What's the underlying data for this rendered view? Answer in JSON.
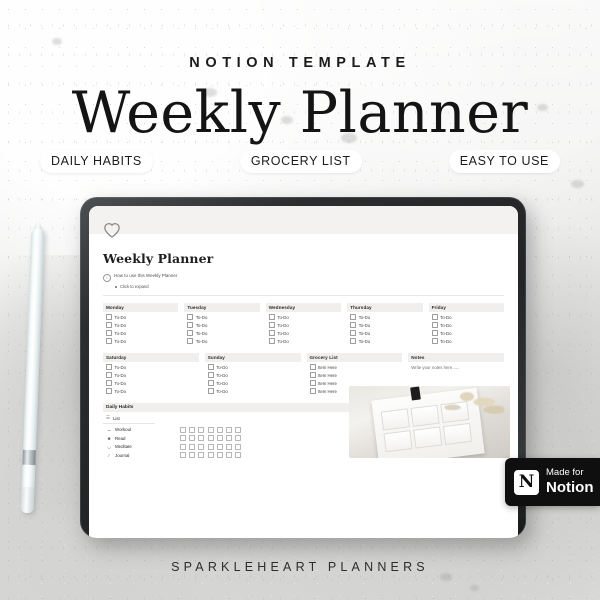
{
  "header": {
    "kicker": "NOTION TEMPLATE",
    "title": "Weekly Planner",
    "pills": [
      {
        "label": "DAILY HABITS"
      },
      {
        "label": "GROCERY LIST"
      },
      {
        "label": "EASY TO USE"
      }
    ]
  },
  "notion_page": {
    "icon": "heart-icon",
    "title": "Weekly Planner",
    "callout": {
      "icon": "info-icon",
      "text": "How to use this Weekly Planner",
      "subitem": "Click to expand"
    },
    "week_columns": [
      {
        "header": "Monday",
        "items": [
          "To-Do",
          "To-Do",
          "To-Do",
          "To-Do"
        ]
      },
      {
        "header": "Tuesday",
        "items": [
          "To-Do",
          "To-Do",
          "To-Do",
          "To-Do"
        ]
      },
      {
        "header": "Wednesday",
        "items": [
          "To-Do",
          "To-Do",
          "To-Do",
          "To-Do"
        ]
      },
      {
        "header": "Thursday",
        "items": [
          "To-Do",
          "To-Do",
          "To-Do",
          "To-Do"
        ]
      },
      {
        "header": "Friday",
        "items": [
          "To-Do",
          "To-Do",
          "To-Do",
          "To-Do"
        ]
      }
    ],
    "second_row_columns": [
      {
        "header": "Saturday",
        "items": [
          "To-Do",
          "To-Do",
          "To-Do",
          "To-Do"
        ]
      },
      {
        "header": "Sunday",
        "items": [
          "To-Do",
          "To-Do",
          "To-Do",
          "To-Do"
        ]
      },
      {
        "header": "Grocery List",
        "items": [
          "Item Here",
          "Item Here",
          "Item Here",
          "Item Here"
        ]
      }
    ],
    "notes": {
      "header": "Notes",
      "placeholder": "Write your notes here......"
    },
    "daily_habits": {
      "header": "Daily Habits",
      "view_tab": {
        "icon": "list-view-icon",
        "label": "List"
      },
      "columns_per_row": 7,
      "rows": [
        {
          "icon": "dumbbell-icon",
          "name": "Workout"
        },
        {
          "icon": "book-icon",
          "name": "Read"
        },
        {
          "icon": "lotus-icon",
          "name": "Meditate"
        },
        {
          "icon": "pencil-icon",
          "name": "Journal"
        }
      ]
    }
  },
  "badge": {
    "logo": "N",
    "line1": "Made for",
    "line2": "Notion"
  },
  "footer": {
    "brand": "SPARKLEHEART PLANNERS"
  },
  "colors": {
    "background": "#ececeb",
    "tablet_bezel": "#232425",
    "page_cover": "#f3f2f0",
    "column_header_bg": "#f0efed",
    "badge_bg": "#0f0f0f",
    "text_dark": "#141414"
  }
}
